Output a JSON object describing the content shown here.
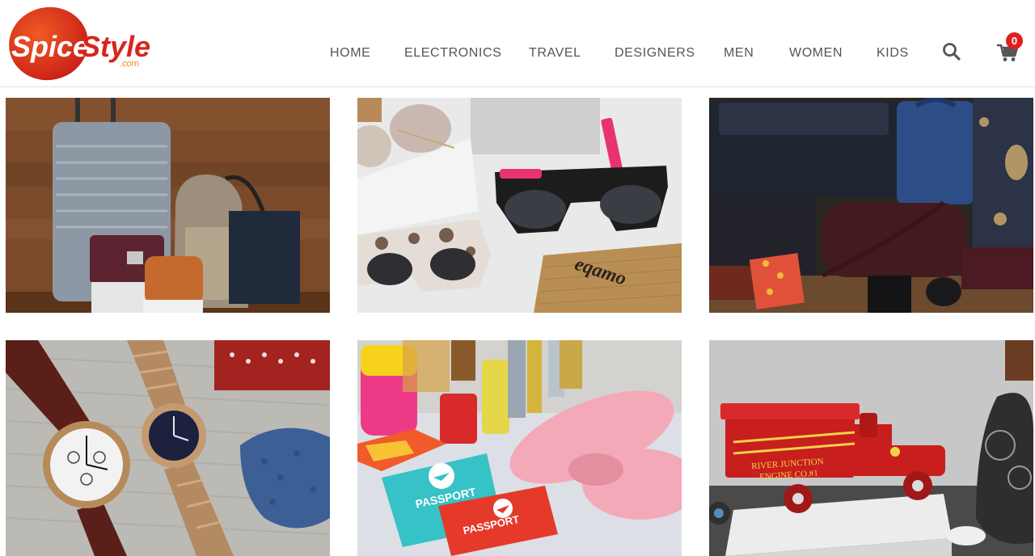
{
  "brand": {
    "name_part1": "Spice",
    "name_part2": "Style",
    "domain_suffix": ".com",
    "logo_color": "#d8261c"
  },
  "nav": {
    "items": [
      {
        "label": "HOME"
      },
      {
        "label": "ELECTRONICS"
      },
      {
        "label": "TRAVEL"
      },
      {
        "label": "DESIGNERS"
      },
      {
        "label": "MEN"
      },
      {
        "label": "WOMEN"
      },
      {
        "label": "KIDS"
      }
    ]
  },
  "header_icons": {
    "search_icon": "search-icon",
    "cart_icon": "cart-icon",
    "cart_count": "0",
    "badge_color": "#e0201f"
  },
  "tiles": [
    {
      "image_text": ""
    },
    {
      "image_text": "eqamo"
    },
    {
      "image_text": ""
    },
    {
      "image_text": ""
    },
    {
      "image_text": "PASSPORT",
      "image_text_2": "PASSPORT"
    },
    {
      "image_text": "RIVER JUNCTION",
      "image_text_2": "ENGINE CO.#1"
    }
  ]
}
